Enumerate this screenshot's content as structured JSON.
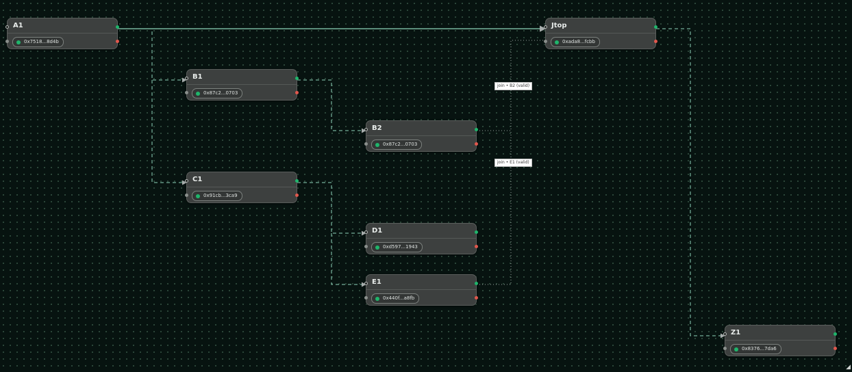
{
  "nodes": {
    "A1": {
      "title": "A1",
      "address": "0x7518...8d4b"
    },
    "B1": {
      "title": "B1",
      "address": "0x87c2...0703"
    },
    "B2": {
      "title": "B2",
      "address": "0x87c2...0703"
    },
    "C1": {
      "title": "C1",
      "address": "0x91cb...3ca9"
    },
    "D1": {
      "title": "D1",
      "address": "0xd597...1943"
    },
    "E1": {
      "title": "E1",
      "address": "0x440f...a8fb"
    },
    "Jtop": {
      "title": "Jtop",
      "address": "0xada8...fcbb"
    },
    "Z1": {
      "title": "Z1",
      "address": "0x8376...7da6"
    }
  },
  "edges": [
    {
      "from": "A1",
      "to": "Jtop",
      "style": "solid"
    },
    {
      "from": "A1",
      "to": "B1",
      "style": "dashed"
    },
    {
      "from": "A1",
      "to": "C1",
      "style": "dashed"
    },
    {
      "from": "B1",
      "to": "B2",
      "style": "dashed"
    },
    {
      "from": "C1",
      "to": "D1",
      "style": "dashed"
    },
    {
      "from": "C1",
      "to": "E1",
      "style": "dashed"
    },
    {
      "from": "B2",
      "to": "Jtop",
      "style": "dotted",
      "label": "join • B2 (valid)"
    },
    {
      "from": "E1",
      "to": "Jtop",
      "style": "dotted",
      "label": "join • E1 (valid)"
    },
    {
      "from": "Jtop",
      "to": "Z1",
      "style": "dashed"
    }
  ],
  "edge_labels": {
    "join_b2": "join • B2 (valid)",
    "join_e1": "join • E1 (valid)"
  },
  "colors": {
    "background": "#071310",
    "edge": "#8fd6bb",
    "join_edge": "#9aa39f",
    "port_out": "#1fb56b",
    "port_error": "#e0574d",
    "status_dot": "#1fb56b"
  }
}
